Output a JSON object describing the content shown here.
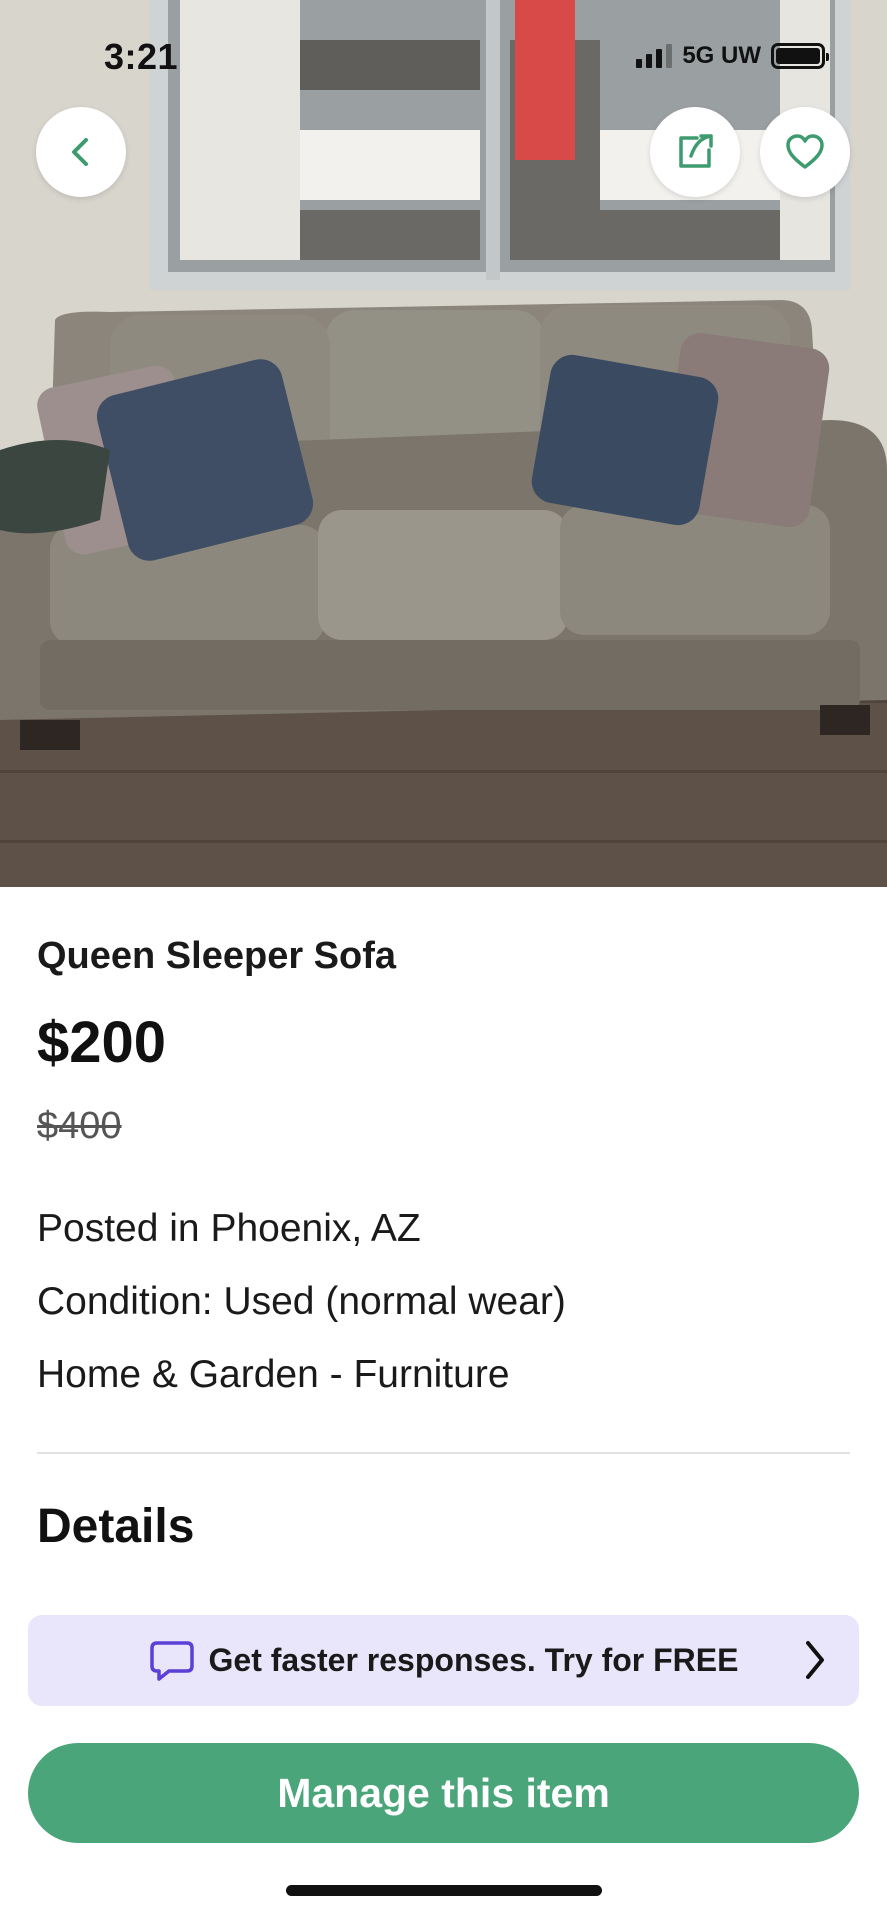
{
  "status_bar": {
    "time": "3:21",
    "network": "5G UW"
  },
  "nav": {
    "back_icon": "chevron-left-icon",
    "share_icon": "share-icon",
    "favorite_icon": "heart-icon"
  },
  "listing": {
    "title": "Queen Sleeper Sofa",
    "price": "$200",
    "original_price": "$400",
    "location": "Posted in Phoenix, AZ",
    "condition": "Condition: Used (normal wear)",
    "category": "Home & Garden - Furniture"
  },
  "details": {
    "heading": "Details"
  },
  "promo": {
    "icon": "chat-bubble-icon",
    "text": "Get faster responses.  Try for FREE"
  },
  "actions": {
    "manage_label": "Manage this item"
  },
  "colors": {
    "accent": "#4aa57a",
    "promo_bg": "#e9e6fb",
    "promo_icon": "#5b3fd6",
    "nav_icon": "#3e9a6f"
  }
}
